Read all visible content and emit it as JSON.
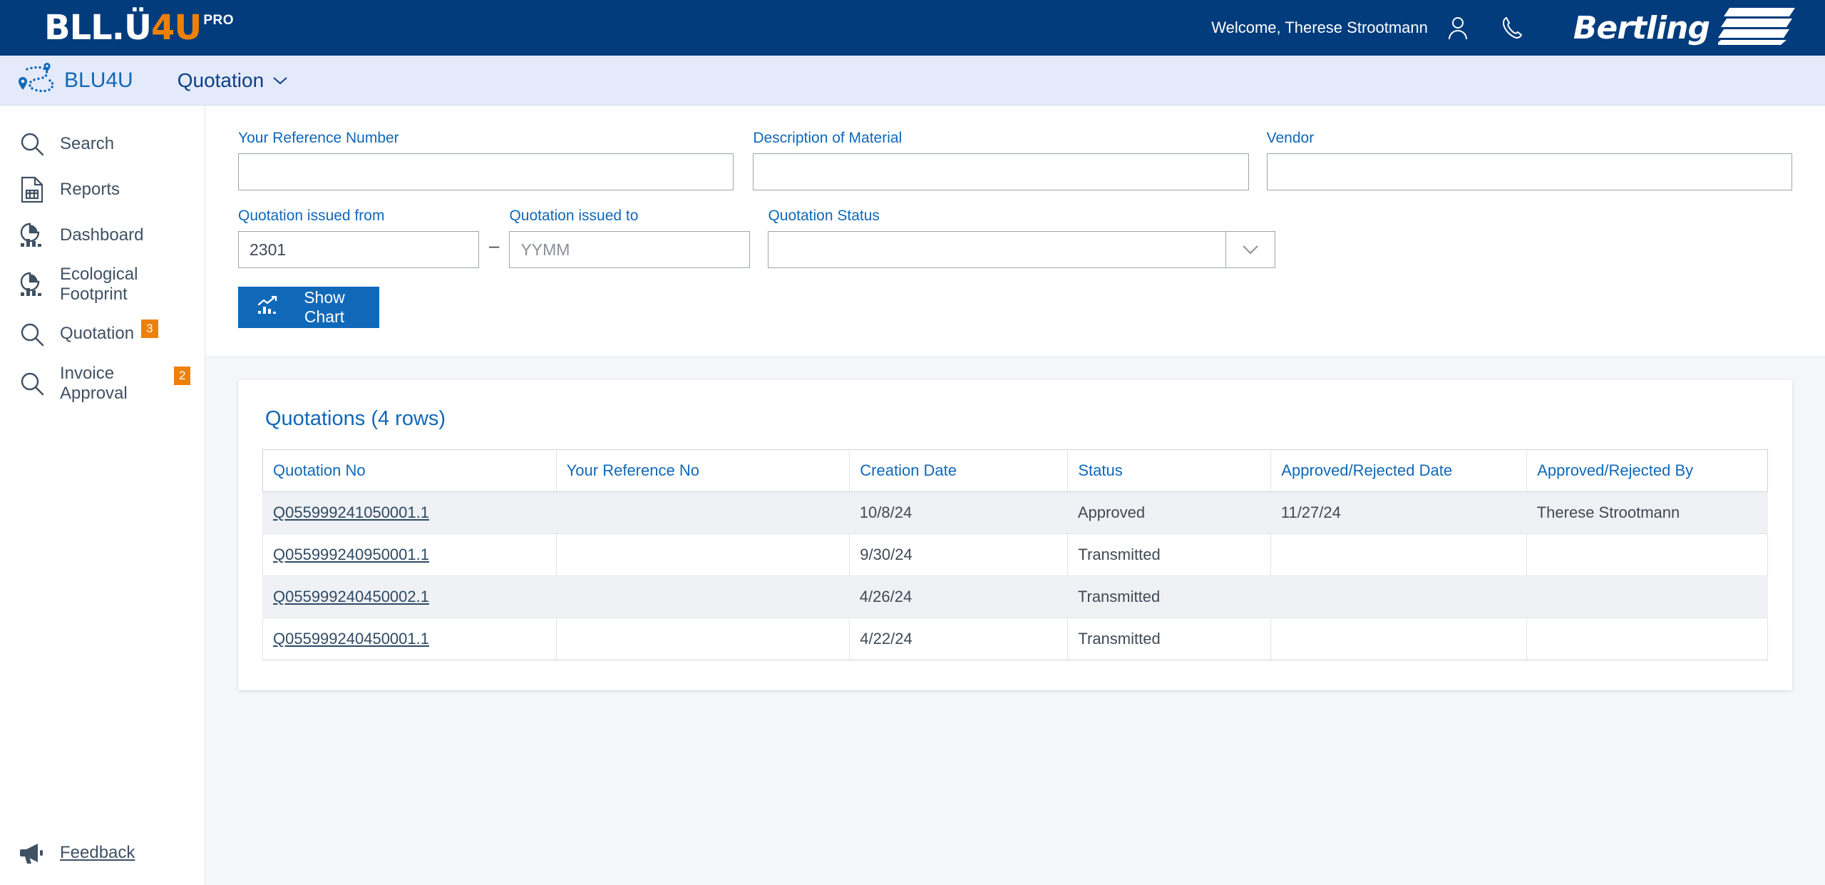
{
  "header": {
    "logo": {
      "blu": "BL",
      "u": "U",
      "four_u": "4U",
      "pro": "PRO",
      "full": "BLU4U PRO"
    },
    "welcome": "Welcome, Therese Strootmann",
    "user_icon": "user-icon",
    "phone_icon": "phone-icon",
    "company": "Bertling",
    "colors": {
      "header_bg": "#023C7D",
      "accent_orange": "#EE8008",
      "link_blue": "#1068B8"
    }
  },
  "subheader": {
    "app_name": "BLU4U",
    "module": "Quotation",
    "module_chevron": "chevron-down-icon",
    "route_icon": "route-pin-icon"
  },
  "sidebar": {
    "items": [
      {
        "label": "Search",
        "icon": "search-icon",
        "badge": ""
      },
      {
        "label": "Reports",
        "icon": "report-document-icon",
        "badge": ""
      },
      {
        "label": "Dashboard",
        "icon": "chart-pie-bar-icon",
        "badge": ""
      },
      {
        "label": "Ecological Footprint",
        "icon": "chart-pie-bar-icon",
        "badge": ""
      },
      {
        "label": "Quotation",
        "icon": "search-icon",
        "badge": "3"
      },
      {
        "label": "Invoice Approval",
        "icon": "search-icon",
        "badge": "2"
      }
    ],
    "feedback": {
      "label": "Feedback",
      "icon": "megaphone-icon"
    }
  },
  "filters": {
    "reference_number": {
      "label": "Your Reference Number",
      "value": "",
      "placeholder": ""
    },
    "description_of_material": {
      "label": "Description of Material",
      "value": "",
      "placeholder": ""
    },
    "vendor": {
      "label": "Vendor",
      "value": "",
      "placeholder": ""
    },
    "issued_from": {
      "label": "Quotation issued from",
      "value": "2301",
      "placeholder": "YYMM"
    },
    "separator": "–",
    "issued_to": {
      "label": "Quotation issued to",
      "value": "",
      "placeholder": "YYMM"
    },
    "status": {
      "label": "Quotation Status",
      "value": "",
      "placeholder": "",
      "arrow_icon": "chevron-down-icon"
    },
    "show_chart_button": {
      "label": "Show Chart",
      "icon": "line-bar-chart-icon"
    }
  },
  "results": {
    "title": "Quotations (4 rows)",
    "columns": [
      "Quotation No",
      "Your Reference No",
      "Creation Date",
      "Status",
      "Approved/Rejected Date",
      "Approved/Rejected By"
    ],
    "rows": [
      {
        "quotation_no": "Q055999241050001.1",
        "your_reference_no": "",
        "creation_date": "10/8/24",
        "status": "Approved",
        "approved_rejected_date": "11/27/24",
        "approved_rejected_by": "Therese Strootmann"
      },
      {
        "quotation_no": "Q055999240950001.1",
        "your_reference_no": "",
        "creation_date": "9/30/24",
        "status": "Transmitted",
        "approved_rejected_date": "",
        "approved_rejected_by": ""
      },
      {
        "quotation_no": "Q055999240450002.1",
        "your_reference_no": "",
        "creation_date": "4/26/24",
        "status": "Transmitted",
        "approved_rejected_date": "",
        "approved_rejected_by": ""
      },
      {
        "quotation_no": "Q055999240450001.1",
        "your_reference_no": "",
        "creation_date": "4/22/24",
        "status": "Transmitted",
        "approved_rejected_date": "",
        "approved_rejected_by": ""
      }
    ]
  }
}
